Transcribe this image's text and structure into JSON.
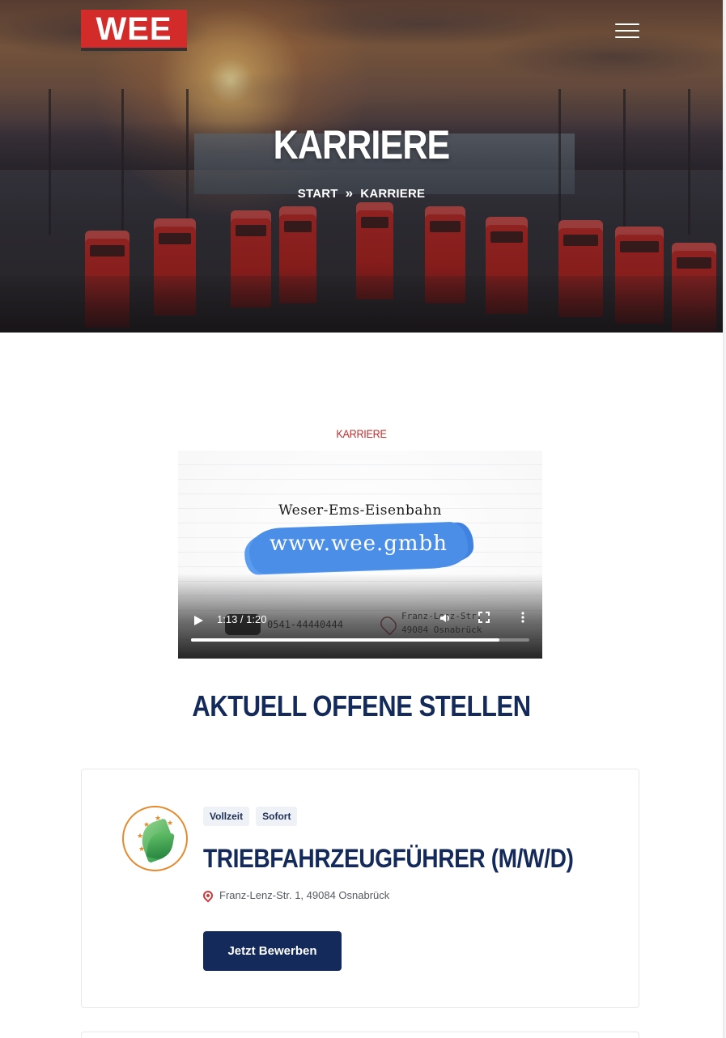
{
  "header": {
    "logo_text": "WEE",
    "menu_icon": "hamburger-menu-icon"
  },
  "hero": {
    "title": "KARRIERE",
    "breadcrumb": {
      "home": "START",
      "separator_icon": "double-chevron-right-icon",
      "current": "KARRIERE"
    }
  },
  "section": {
    "label": "KARRIERE"
  },
  "video": {
    "brand_text": "Weser-Ems-Eisenbahn",
    "url_text": "www.wee.gmbh",
    "phone_text": "0541-44440444",
    "address_line1": "Franz-Lenz-Str.",
    "address_line2": "49084 Osnabrück",
    "time": "1:13 / 1:20",
    "progress": 0.9125,
    "icons": {
      "play": "play-icon",
      "volume": "volume-icon",
      "fullscreen": "fullscreen-icon",
      "more": "more-vertical-icon"
    }
  },
  "jobs": {
    "heading": "AKTUELL OFFENE STELLEN",
    "items": [
      {
        "tags": [
          "Vollzeit",
          "Sofort"
        ],
        "title": "TRIEBFAHRZEUGFÜHRER (M/W/D)",
        "location": "Franz-Lenz-Str. 1, 49084 Osnabrück",
        "apply_label": "Jetzt Bewerben"
      }
    ]
  },
  "colors": {
    "brand_red": "#d32a2a",
    "navy": "#142a5a",
    "accent_red": "#c42b2b",
    "tag_bg": "#eef1f6"
  }
}
